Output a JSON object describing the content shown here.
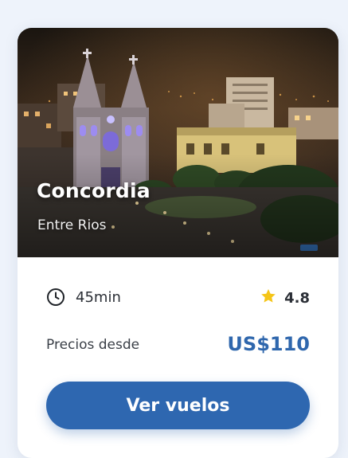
{
  "destination": {
    "city": "Concordia",
    "region": "Entre Rios",
    "image_alt": "Vista nocturna de la catedral de Concordia"
  },
  "details": {
    "duration_icon": "clock-icon",
    "duration": "45min",
    "rating_icon": "star-icon",
    "rating": "4.8"
  },
  "price": {
    "label": "Precios desde",
    "value": "US$110"
  },
  "cta": {
    "label": "Ver vuelos"
  },
  "colors": {
    "accent": "#2e67b0",
    "price": "#2f67ad",
    "star": "#f5c518",
    "text": "#2b2f36"
  }
}
